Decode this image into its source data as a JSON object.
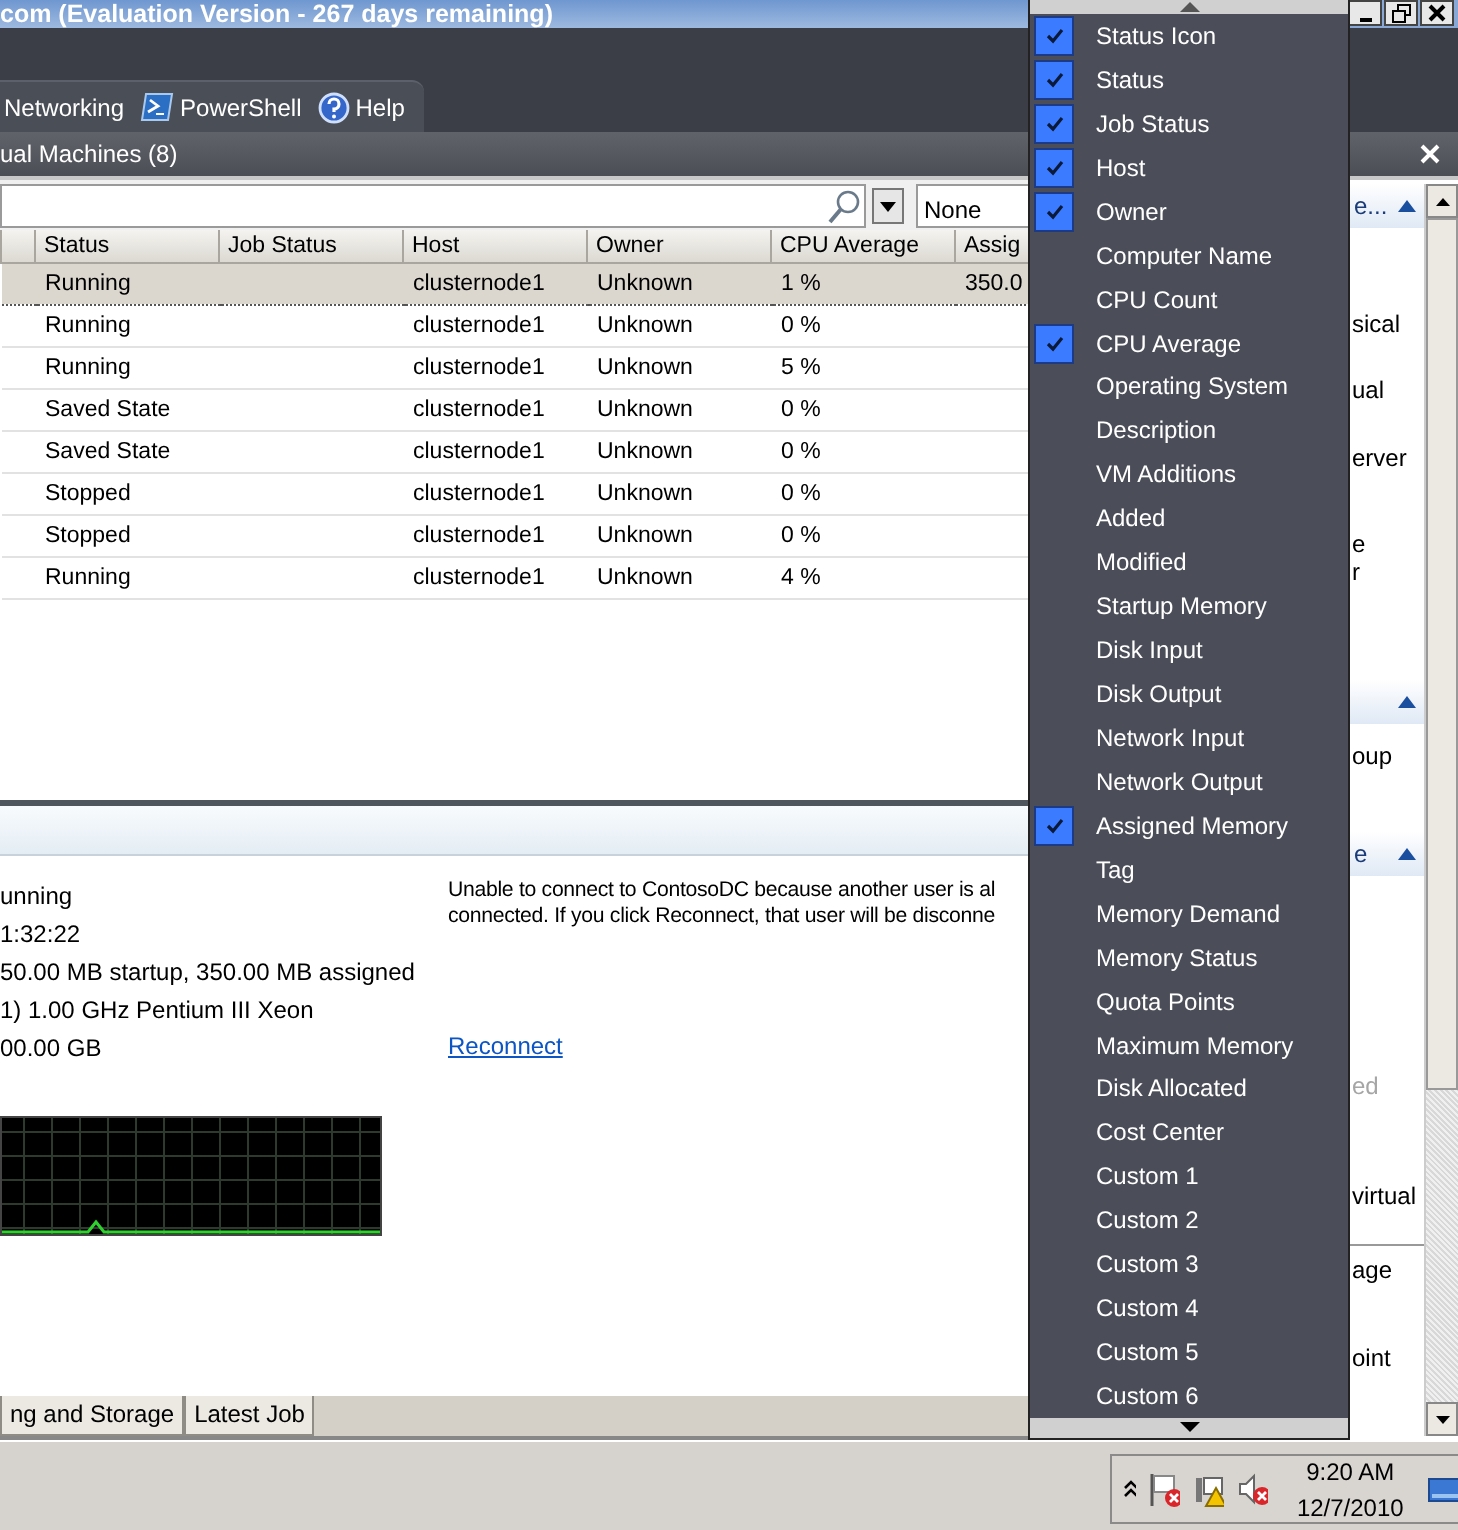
{
  "window": {
    "title": "com (Evaluation Version - 267 days remaining)"
  },
  "toolbar_tabs": [
    {
      "label": "Networking",
      "kind": "plain"
    },
    {
      "label": "PowerShell",
      "kind": "powershell"
    },
    {
      "label": "Help",
      "kind": "help"
    }
  ],
  "panel": {
    "title": "ual Machines (8)"
  },
  "filter": {
    "value": "None"
  },
  "table": {
    "columns": [
      "Status",
      "Job Status",
      "Host",
      "Owner",
      "CPU Average",
      "Assig"
    ],
    "rows": [
      {
        "status": "Running",
        "host": "clusternode1",
        "owner": "Unknown",
        "cpu_average": "1 %",
        "column_6": "350.0",
        "selected": true
      },
      {
        "status": "Running",
        "host": "clusternode1",
        "owner": "Unknown",
        "cpu_average": "0 %",
        "selected": false
      },
      {
        "status": "Running",
        "host": "clusternode1",
        "owner": "Unknown",
        "cpu_average": "5 %",
        "selected": false
      },
      {
        "status": "Saved State",
        "host": "clusternode1",
        "owner": "Unknown",
        "cpu_average": "0 %",
        "selected": false
      },
      {
        "status": "Saved State",
        "host": "clusternode1",
        "owner": "Unknown",
        "cpu_average": "0 %",
        "selected": false
      },
      {
        "status": "Stopped",
        "host": "clusternode1",
        "owner": "Unknown",
        "cpu_average": "0 %",
        "selected": false
      },
      {
        "status": "Stopped",
        "host": "clusternode1",
        "owner": "Unknown",
        "cpu_average": "0 %",
        "selected": false
      },
      {
        "status": "Running",
        "host": "clusternode1",
        "owner": "Unknown",
        "cpu_average": "4 %",
        "selected": false
      }
    ]
  },
  "details": {
    "lines": [
      "unning",
      "1:32:22",
      "50.00 MB startup, 350.00 MB assigned",
      "1) 1.00 GHz Pentium III Xeon",
      "00.00 GB"
    ],
    "message": [
      "Unable to connect to ContosoDC because another user is al",
      "connected. If you click Reconnect, that user will be disconne"
    ],
    "link": "Reconnect",
    "tabs": [
      "ng and Storage",
      "Latest Job"
    ]
  },
  "actions": [
    {
      "kind": "header",
      "text": "e..."
    },
    {
      "kind": "item",
      "text": "sical"
    },
    {
      "kind": "item",
      "text": "ual"
    },
    {
      "kind": "item",
      "text": "erver"
    },
    {
      "kind": "item",
      "text": "e"
    },
    {
      "kind": "item",
      "text": "r"
    },
    {
      "kind": "header"
    },
    {
      "kind": "item",
      "text": "oup"
    },
    {
      "kind": "header",
      "text": "e"
    },
    {
      "kind": "disabled",
      "text": "ed"
    },
    {
      "kind": "item",
      "text": "virtual"
    },
    {
      "kind": "divider"
    },
    {
      "kind": "item",
      "text": "age"
    },
    {
      "kind": "item",
      "text": "oint"
    }
  ],
  "column_menu": {
    "items": [
      {
        "label": "Status Icon",
        "checked": true
      },
      {
        "label": "Status",
        "checked": true
      },
      {
        "label": "Job Status",
        "checked": true
      },
      {
        "label": "Host",
        "checked": true
      },
      {
        "label": "Owner",
        "checked": true
      },
      {
        "label": "Computer Name",
        "checked": false
      },
      {
        "label": "CPU Count",
        "checked": false
      },
      {
        "label": "CPU Average",
        "checked": true
      },
      {
        "label": "Operating System",
        "checked": false
      },
      {
        "label": "Description",
        "checked": false
      },
      {
        "label": "VM Additions",
        "checked": false
      },
      {
        "label": "Added",
        "checked": false
      },
      {
        "label": "Modified",
        "checked": false
      },
      {
        "label": "Startup Memory",
        "checked": false
      },
      {
        "label": "Disk Input",
        "checked": false
      },
      {
        "label": "Disk Output",
        "checked": false
      },
      {
        "label": "Network Input",
        "checked": false
      },
      {
        "label": "Network Output",
        "checked": false
      },
      {
        "label": "Assigned Memory",
        "checked": true
      },
      {
        "label": "Tag",
        "checked": false
      },
      {
        "label": "Memory Demand",
        "checked": false
      },
      {
        "label": "Memory Status",
        "checked": false
      },
      {
        "label": "Quota Points",
        "checked": false
      },
      {
        "label": "Maximum Memory",
        "checked": false
      },
      {
        "label": "Disk Allocated",
        "checked": false
      },
      {
        "label": "Cost Center",
        "checked": false
      },
      {
        "label": "Custom 1",
        "checked": false
      },
      {
        "label": "Custom 2",
        "checked": false
      },
      {
        "label": "Custom 3",
        "checked": false
      },
      {
        "label": "Custom 4",
        "checked": false
      },
      {
        "label": "Custom 5",
        "checked": false
      },
      {
        "label": "Custom 6",
        "checked": false
      }
    ]
  },
  "taskbar": {
    "time": "9:20 AM",
    "date": "12/7/2010"
  }
}
